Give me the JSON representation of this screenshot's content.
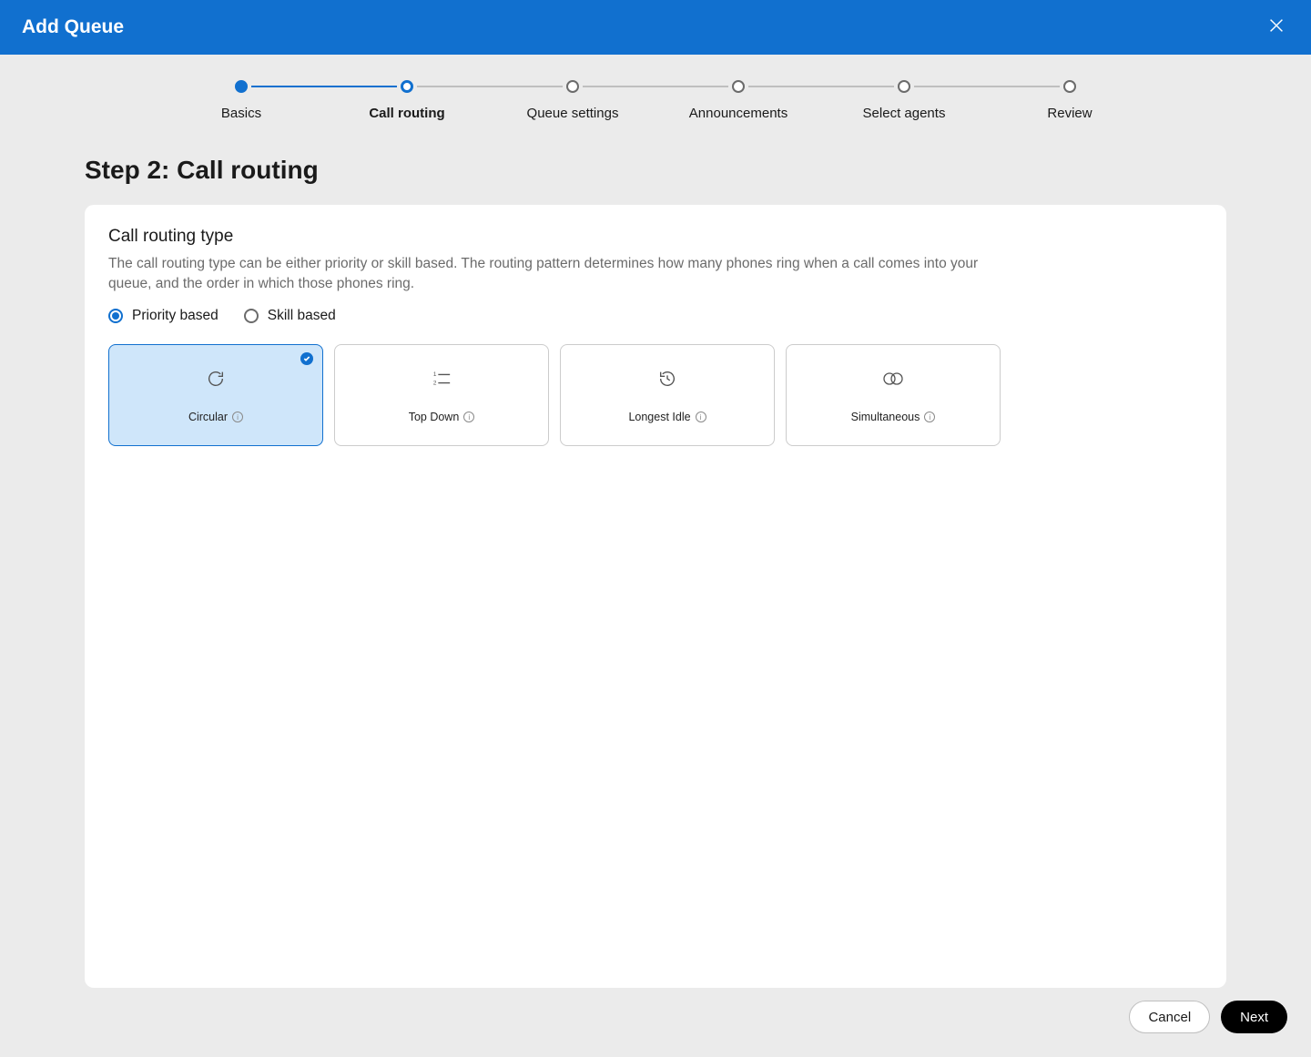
{
  "header": {
    "title": "Add Queue"
  },
  "stepper": {
    "steps": [
      {
        "label": "Basics",
        "state": "complete"
      },
      {
        "label": "Call routing",
        "state": "current"
      },
      {
        "label": "Queue settings",
        "state": "upcoming"
      },
      {
        "label": "Announcements",
        "state": "upcoming"
      },
      {
        "label": "Select agents",
        "state": "upcoming"
      },
      {
        "label": "Review",
        "state": "upcoming"
      }
    ]
  },
  "page": {
    "title": "Step 2: Call routing"
  },
  "section": {
    "title": "Call routing type",
    "description": "The call routing type can be either priority or skill based. The routing pattern determines how many phones ring when a call comes into your queue, and the order in which those phones ring."
  },
  "radios": {
    "selected": "priority",
    "priority_label": "Priority based",
    "skill_label": "Skill based"
  },
  "options": {
    "selected": "circular",
    "items": [
      {
        "key": "circular",
        "label": "Circular",
        "icon": "cycle"
      },
      {
        "key": "topdown",
        "label": "Top Down",
        "icon": "ordered-list"
      },
      {
        "key": "longestidle",
        "label": "Longest Idle",
        "icon": "history"
      },
      {
        "key": "simultaneous",
        "label": "Simultaneous",
        "icon": "two-circles"
      }
    ]
  },
  "footer": {
    "cancel": "Cancel",
    "next": "Next"
  }
}
